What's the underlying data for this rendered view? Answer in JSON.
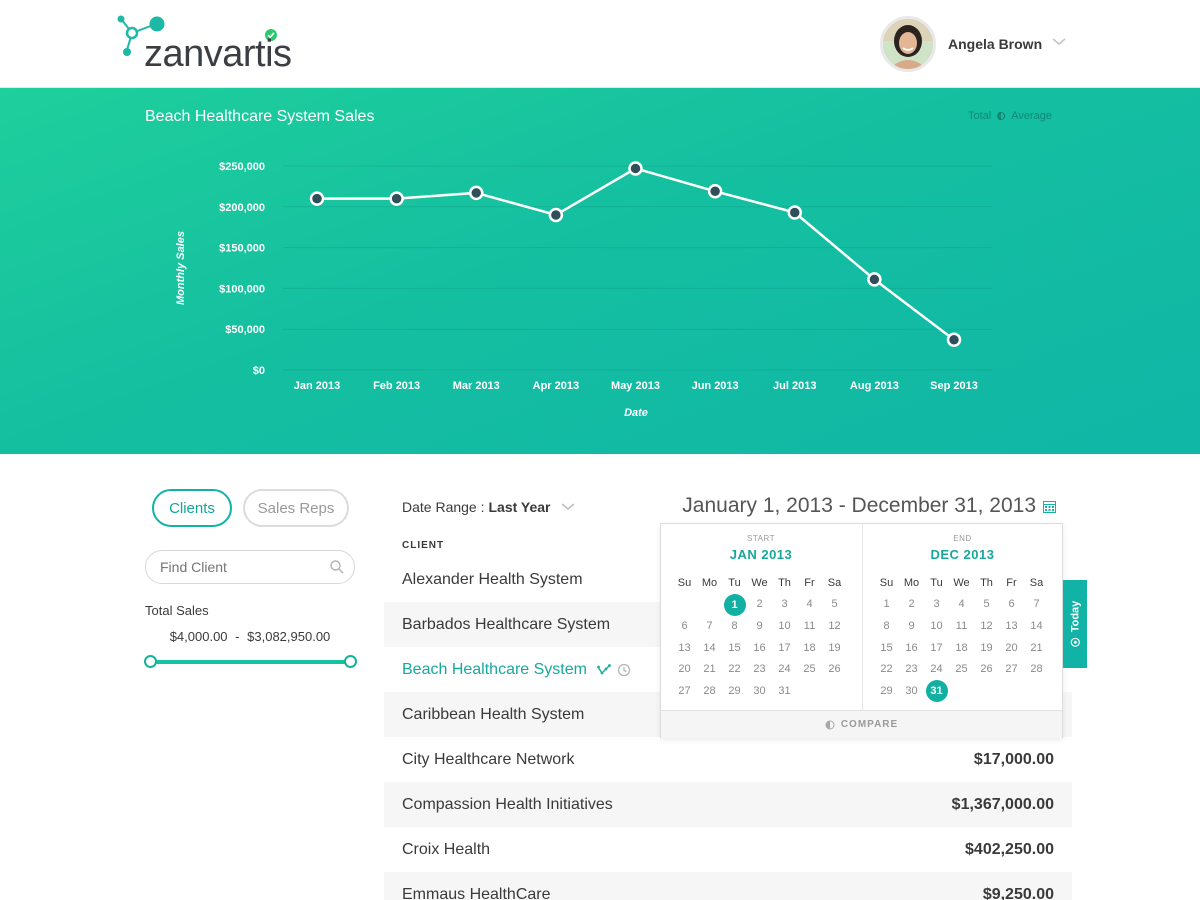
{
  "brand": {
    "name": "zanvartis"
  },
  "user": {
    "name": "Angela Brown"
  },
  "hero": {
    "toggle": {
      "option_a": "Total",
      "option_b": "Average"
    }
  },
  "chart_data": {
    "type": "line",
    "title": "Beach Healthcare System Sales",
    "xlabel": "Date",
    "ylabel": "Monthly Sales",
    "categories": [
      "Jan 2013",
      "Feb 2013",
      "Mar 2013",
      "Apr 2013",
      "May 2013",
      "Jun 2013",
      "Jul 2013",
      "Aug 2013",
      "Sep 2013"
    ],
    "values": [
      210000,
      210000,
      217000,
      190000,
      247000,
      219000,
      193000,
      111000,
      37000
    ],
    "ylim": [
      0,
      250000
    ],
    "yticks": [
      "$0",
      "$50,000",
      "$100,000",
      "$150,000",
      "$200,000",
      "$250,000"
    ],
    "grid": true,
    "colors": {
      "line": "#ffffff",
      "marker_fill": "#2f4f5a",
      "marker_stroke": "#ffffff"
    }
  },
  "filters": {
    "tab_clients": "Clients",
    "tab_sales_reps": "Sales Reps",
    "search_placeholder": "Find Client",
    "total_sales_label": "Total Sales",
    "range_min": "$4,000.00",
    "range_sep": "-",
    "range_max": "$3,082,950.00"
  },
  "table": {
    "date_range_label": "Date Range :",
    "date_range_value": "Last Year",
    "date_display": "January 1, 2013 - December 31, 2013",
    "col_client": "CLIENT",
    "rows": [
      {
        "name": "Alexander Health System",
        "amount": ""
      },
      {
        "name": "Barbados Healthcare System",
        "amount": ""
      },
      {
        "name": "Beach Healthcare System",
        "amount": ""
      },
      {
        "name": "Caribbean Health System",
        "amount": ""
      },
      {
        "name": "City Healthcare Network",
        "amount": "$17,000.00"
      },
      {
        "name": "Compassion Health Initiatives",
        "amount": "$1,367,000.00"
      },
      {
        "name": "Croix Health",
        "amount": "$402,250.00"
      },
      {
        "name": "Emmaus HealthCare",
        "amount": "$9,250.00"
      }
    ]
  },
  "calendar": {
    "start_caption": "START",
    "start_title": "JAN 2013",
    "end_caption": "END",
    "end_title": "DEC 2013",
    "weekdays": [
      "Su",
      "Mo",
      "Tu",
      "We",
      "Th",
      "Fr",
      "Sa"
    ],
    "start_offset": 2,
    "start_days": 31,
    "start_selected": 1,
    "end_offset": 0,
    "end_days": 31,
    "end_selected": 31,
    "compare_label": "COMPARE",
    "today_label": "Today"
  },
  "colors": {
    "accent": "#12b3a7",
    "hero_start": "#1fcf9c",
    "hero_end": "#10b6a6"
  }
}
